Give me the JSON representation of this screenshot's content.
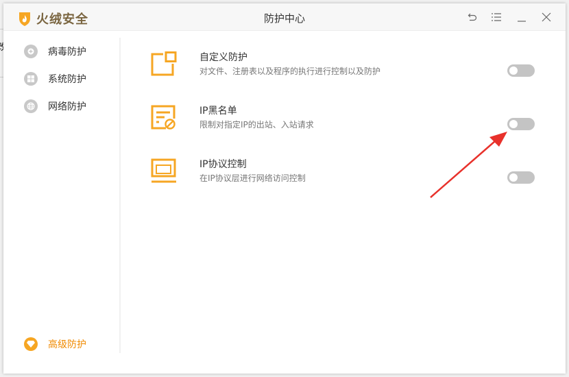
{
  "background": {
    "partial_text": "改"
  },
  "window": {
    "app_name": "火绒安全",
    "title": "防护中心",
    "controls": [
      "back",
      "menu",
      "minimize",
      "close"
    ]
  },
  "sidebar": {
    "items": [
      {
        "label": "病毒防护",
        "icon": "plus-circle-icon"
      },
      {
        "label": "系统防护",
        "icon": "windows-icon"
      },
      {
        "label": "网络防护",
        "icon": "globe-icon"
      }
    ],
    "bottom_item": {
      "label": "高级防护",
      "icon": "diamond-icon",
      "active": true
    }
  },
  "main": {
    "items": [
      {
        "name": "自定义防护",
        "desc": "对文件、注册表以及程序的执行进行控制以及防护",
        "enabled": false
      },
      {
        "name": "IP黑名单",
        "desc": "限制对指定IP的出站、入站请求",
        "enabled": false
      },
      {
        "name": "IP协议控制",
        "desc": "在IP协议层进行网络访问控制",
        "enabled": false
      }
    ]
  },
  "colors": {
    "accent": "#f6a623",
    "active_text": "#f08a00",
    "toggle_off": "#c4c4c4",
    "arrow": "#e8312b"
  }
}
